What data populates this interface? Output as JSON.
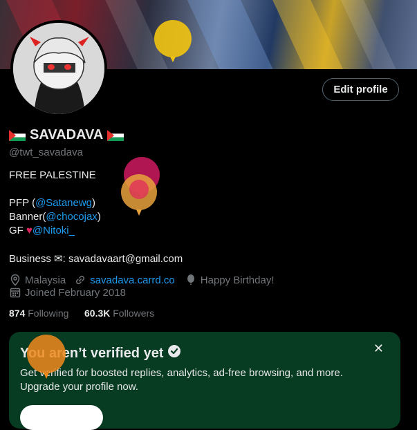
{
  "profile": {
    "display_name": "SAVADAVA",
    "handle": "@twt_savadava",
    "edit_button": "Edit profile",
    "bio": {
      "line1": "FREE PALESTINE",
      "pfp_prefix": "PFP (",
      "pfp_link": "@Satanewg",
      "pfp_suffix": ")",
      "banner_prefix": "Banner(",
      "banner_link": "@chocojax",
      "banner_suffix": ")",
      "gf_prefix": "GF ",
      "gf_link": "@Nitoki_",
      "business_prefix": "Business ",
      "business_suffix": ": savadavaart@gmail.com"
    },
    "location": "Malaysia",
    "website": "savadava.carrd.co",
    "birthday": "Happy Birthday!",
    "joined": "Joined February 2018",
    "following_count": "874",
    "following_label": "Following",
    "followers_count": "60.3K",
    "followers_label": "Followers"
  },
  "verify_card": {
    "title": "You aren’t verified yet",
    "text": "Get verified for boosted replies, analytics, ad-free browsing, and more. Upgrade your profile now.",
    "close": "✕"
  },
  "icons": [
    "location-icon",
    "link-icon",
    "balloon-icon",
    "calendar-icon",
    "verified-badge-icon",
    "envelope-icon",
    "heart-icon"
  ],
  "colors": {
    "accent": "#1d9bf0",
    "muted": "#71767b",
    "card_bg": "#073b22"
  }
}
